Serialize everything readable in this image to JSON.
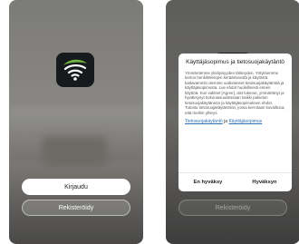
{
  "colors": {
    "accent_link": "#2f6fb6",
    "icon_green": "#6db33f",
    "icon_bg": "#161a1c"
  },
  "left_screen": {
    "app_icon": "wifi-leaf-app-icon",
    "login_label": "Kirjaudu",
    "register_label": "Rekisteröidy"
  },
  "right_screen": {
    "dialog": {
      "title": "Käyttäjäsopimus ja tietosuojakäytäntö",
      "body": "Ymmärrämme yksityisyyden tärkeyden. Yrityksemme kertoo henkilötietojen keräämisestä ja käytöstä kattavammin olemme uudistaneet tietosuojakäytäntöä ja käyttäjäsopimusta. Lue ehdot huolellisesti ennen käyttöä. Kun valitset [Agree], olet lukenut, ymmärtänyt ja hyväksynyt kokonaisuudessaan kaikki palvelun tietosuojakäytännön ja käyttäjäsopimuksen ehdot. Tutustu tietosuojakäytäntöön, jossa kerrotaan kuvailtuna, että meihin yhteys.",
      "link_privacy": "Tietosuojakäytäntö",
      "link_separator": " ja ",
      "link_agreement": "Käyttäjäsopimus",
      "decline_label": "En hyväksy",
      "accept_label": "Hyväksyn"
    }
  }
}
